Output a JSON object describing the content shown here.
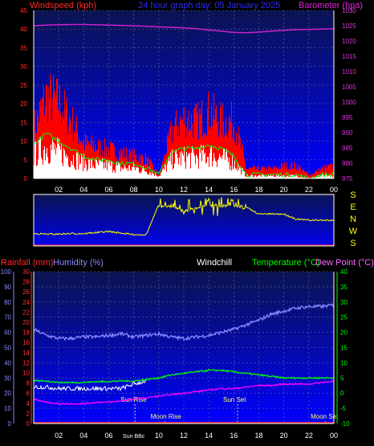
{
  "header": {
    "left_label": "Windspeed (kph)",
    "title": "24 hour graph day: 05 January 2025",
    "right_label": "Barometer (hpa)"
  },
  "colors": {
    "background": "#000000",
    "plot_bg_top": "#0a1450",
    "plot_bg_bottom": "#0000ff",
    "axis": "#ffffff",
    "wind": "#ff0000",
    "wind_avg": "#00ff00",
    "gust_low": "#ffffff",
    "barometer": "#cc22cc",
    "direction": "#ffff00",
    "rain": "#ff2222",
    "humidity": "#8888ff",
    "temperature": "#00ff00",
    "dewpoint": "#ff00ff",
    "windchill": "#ffffff",
    "markers": "#ffff66"
  },
  "x_ticks": [
    "02",
    "04",
    "06",
    "08",
    "10",
    "12",
    "14",
    "16",
    "18",
    "20",
    "22",
    "00"
  ],
  "chart_data": [
    {
      "type": "line",
      "name_left": "Windspeed (kph)",
      "name_right": "Barometer (hpa)",
      "ylim_left": [
        0,
        45
      ],
      "ylim_right": [
        975,
        1030
      ],
      "left_ticks": [
        "0",
        "5",
        "10",
        "15",
        "20",
        "25",
        "30",
        "35",
        "40",
        "45"
      ],
      "right_ticks": [
        "975",
        "980",
        "985",
        "990",
        "995",
        "1000",
        "1005",
        "1010",
        "1015",
        "1020",
        "1025",
        "1030"
      ],
      "x_hours": [
        0,
        1,
        2,
        3,
        4,
        5,
        6,
        7,
        8,
        9,
        10,
        11,
        12,
        13,
        14,
        15,
        16,
        17,
        18,
        19,
        20,
        21,
        22,
        23,
        24
      ],
      "series": [
        {
          "name": "Gust",
          "values": [
            16,
            26,
            24,
            18,
            11,
            10,
            9,
            8,
            7,
            6,
            1,
            15,
            19,
            18,
            21,
            18,
            18,
            3,
            3,
            3,
            4,
            4,
            1,
            3,
            4
          ]
        },
        {
          "name": "Average",
          "values": [
            9,
            12,
            10,
            8,
            6,
            5,
            5,
            4,
            4,
            3,
            1,
            7,
            8,
            8,
            9,
            8,
            6,
            1,
            1,
            1,
            1,
            1,
            0,
            1,
            1
          ]
        },
        {
          "name": "Barometer",
          "values": [
            1025,
            1025.2,
            1025.3,
            1025.4,
            1025.4,
            1025.3,
            1025.2,
            1025.1,
            1025,
            1024.8,
            1024.6,
            1024.5,
            1024.3,
            1024,
            1023.6,
            1023.2,
            1022.8,
            1022.7,
            1022.9,
            1023.2,
            1023.5,
            1023.7,
            1023.8,
            1023.9,
            1024
          ]
        }
      ]
    },
    {
      "type": "line",
      "name": "Wind Direction",
      "direction_labels": [
        "S",
        "E",
        "N",
        "W",
        "S"
      ],
      "x_hours": [
        0,
        1,
        2,
        3,
        4,
        5,
        6,
        7,
        8,
        9,
        10,
        11,
        12,
        13,
        14,
        15,
        16,
        17,
        18,
        19,
        20,
        21,
        22,
        23,
        24
      ],
      "series": [
        {
          "name": "Direction",
          "values": [
            0.76,
            0.77,
            0.77,
            0.76,
            0.76,
            0.74,
            0.72,
            0.75,
            0.78,
            0.78,
            0.2,
            0.22,
            0.3,
            0.25,
            0.2,
            0.2,
            0.2,
            0.25,
            0.38,
            0.38,
            0.38,
            0.48,
            0.5,
            0.5,
            0.5
          ]
        }
      ]
    },
    {
      "type": "line",
      "left_label_rain": "Rainfall (mm)",
      "left_label_humidity": "Humidity (%)",
      "label_windchill": "Windchill",
      "label_temperature": "Temperature (°C)",
      "label_dewpoint": "Dew Point (°C)",
      "rain_ticks": [
        "0",
        "2",
        "4",
        "6",
        "8",
        "10",
        "12",
        "14",
        "16",
        "18",
        "20",
        "22",
        "24",
        "26",
        "28",
        "30"
      ],
      "humidity_ticks": [
        "0",
        "10",
        "20",
        "30",
        "40",
        "50",
        "60",
        "70",
        "80",
        "90",
        "100"
      ],
      "temp_ticks": [
        "-10",
        "-5",
        "0",
        "5",
        "10",
        "15",
        "20",
        "25",
        "30",
        "35",
        "40"
      ],
      "ylim_humidity": [
        0,
        100
      ],
      "ylim_temperature": [
        -10,
        40
      ],
      "x_hours": [
        0,
        1,
        2,
        3,
        4,
        5,
        6,
        7,
        8,
        9,
        10,
        11,
        12,
        13,
        14,
        15,
        16,
        17,
        18,
        19,
        20,
        21,
        22,
        23,
        24
      ],
      "series": [
        {
          "name": "Humidity",
          "values": [
            62,
            58,
            56,
            56,
            57,
            57,
            58,
            59,
            57,
            58,
            59,
            57,
            56,
            57,
            58,
            60,
            62,
            65,
            68,
            72,
            74,
            76,
            77,
            77,
            78
          ]
        },
        {
          "name": "Temperature",
          "values": [
            4,
            4,
            3.5,
            3.5,
            3.5,
            3.8,
            3.8,
            4,
            4,
            4.5,
            5,
            6,
            6.5,
            7,
            7.5,
            7.5,
            7,
            6.5,
            6,
            5.5,
            5,
            5,
            5,
            5,
            5
          ]
        },
        {
          "name": "Windchill",
          "values": [
            2,
            2,
            1.5,
            1.5,
            1.5,
            1.5,
            1.5,
            1.5,
            3,
            4,
            5,
            6,
            6.5,
            7,
            7.5,
            7.5,
            7,
            6.5,
            6,
            5.5,
            5,
            5,
            5,
            5,
            5
          ]
        },
        {
          "name": "Dew Point",
          "values": [
            -2,
            -3,
            -3.5,
            -3.5,
            -3.5,
            -3,
            -3,
            -2.5,
            -2,
            -1.5,
            -1,
            -0.5,
            0,
            0.5,
            1,
            1.5,
            1.5,
            2,
            2.5,
            2.5,
            3,
            3,
            3,
            3.5,
            4
          ]
        },
        {
          "name": "Rainfall",
          "values": [
            0,
            0,
            0,
            0,
            0,
            0,
            0,
            0,
            0,
            0,
            0,
            0,
            0,
            0,
            0,
            0,
            0,
            0,
            0,
            0,
            0,
            0,
            0,
            0,
            0
          ]
        }
      ],
      "markers": [
        {
          "label": "Sun Rise",
          "hour": 8.1
        },
        {
          "label": "Moon Rise",
          "hour": 10.5
        },
        {
          "label": "Sun Set",
          "hour": 16.3
        },
        {
          "label": "Moon Set",
          "hour": 23.3
        }
      ],
      "footer_tag": "Sun BBc"
    }
  ]
}
